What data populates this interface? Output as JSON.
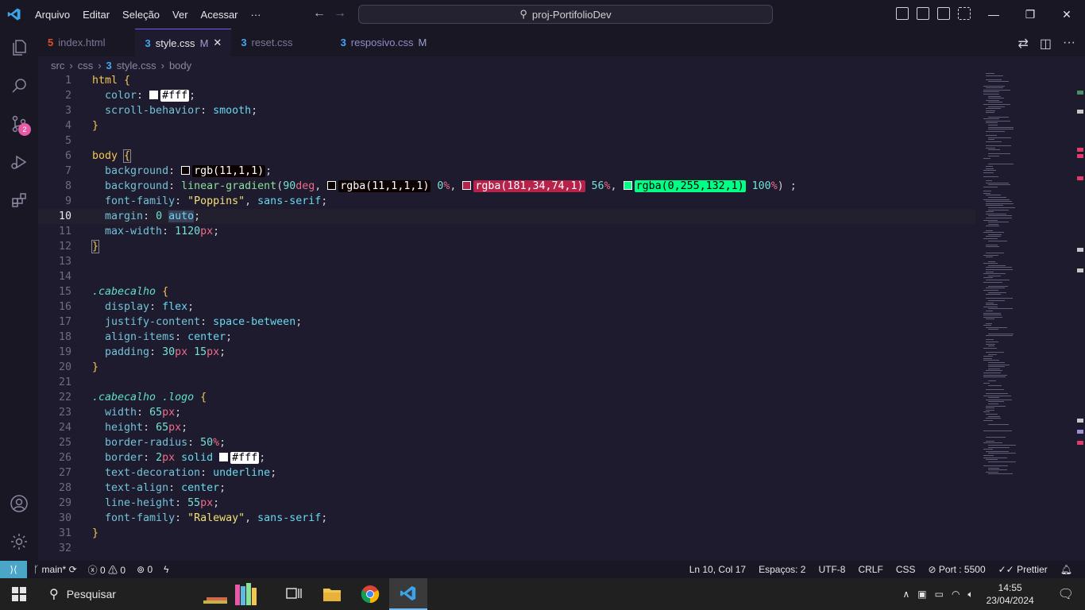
{
  "menu": [
    "Arquivo",
    "Editar",
    "Seleção",
    "Ver",
    "Acessar",
    "···"
  ],
  "command_center": "proj-PortifolioDev",
  "tabs": [
    {
      "label": "index.html",
      "mark": "",
      "icon": "html5-icon"
    },
    {
      "label": "style.css",
      "mark": "M",
      "icon": "css3-icon"
    },
    {
      "label": "reset.css",
      "mark": "",
      "icon": "css3-icon"
    },
    {
      "label": "resposivo.css",
      "mark": "M",
      "icon": "css3-icon"
    }
  ],
  "breadcrumb": [
    "src",
    "css",
    "style.css",
    "body"
  ],
  "activity_badge": "2",
  "code_lines": [
    {
      "n": "1",
      "html": "<span class='sel'>html</span> <span class='sel'>{</span>"
    },
    {
      "n": "2",
      "html": "  <span class='prop'>color</span>: <span class='chip' style='background:#fff'></span><span class='cbox' style='background:#fff;color:#000'>#fff</span>;"
    },
    {
      "n": "3",
      "html": "  <span class='prop'>scroll-behavior</span>: <span class='val'>smooth</span>;"
    },
    {
      "n": "4",
      "html": "<span class='sel'>}</span>"
    },
    {
      "n": "5",
      "html": ""
    },
    {
      "n": "6",
      "html": "<span class='sel'>body</span> <span class='sel' style='outline:1px solid #888'>{</span>"
    },
    {
      "n": "7",
      "html": "  <span class='prop'>background</span>: <span class='chip' style='background:#0b0101'></span><span class='cbox' style='background:#0b0101;color:#fff'>rgb(11,1,1)</span>;"
    },
    {
      "n": "8",
      "html": "  <span class='prop'>background</span>: <span class='fn'>linear-gradient</span>(<span class='num'>90</span><span class='unit'>deg</span>, <span class='chip' style='background:#0b0101'></span><span class='cbox' style='background:#0b0101;color:#fff'>rgba(11,1,1,1)</span> <span class='num'>0</span><span class='unit'>%</span>, <span class='chip' style='background:#b5224a'></span><span class='cbox' style='background:#b5224a;color:#fff'>rgba(181,34,74,1)</span> <span class='num'>56</span><span class='unit'>%</span>, <span class='chip' style='background:#00ff84'></span><span class='cbox' style='background:#00ff84;color:#000'>rgba(0,255,132,1)</span> <span class='num'>100</span><span class='unit'>%</span>) ;"
    },
    {
      "n": "9",
      "html": "  <span class='prop'>font-family</span>: <span class='str'>\"Poppins\"</span>, <span class='val'>sans-serif</span>;"
    },
    {
      "n": "10",
      "html": "  <span class='prop'>margin</span>: <span class='num'>0</span> <span class='val' style='background:#3a3f5a'>auto</span>;",
      "cur": true
    },
    {
      "n": "11",
      "html": "  <span class='prop'>max-width</span>: <span class='num'>1120</span><span class='unit'>px</span>;"
    },
    {
      "n": "12",
      "html": "<span class='sel' style='outline:1px solid #888'>}</span>"
    },
    {
      "n": "13",
      "html": ""
    },
    {
      "n": "14",
      "html": ""
    },
    {
      "n": "15",
      "html": "<span class='cls'>.cabecalho</span> <span class='sel'>{</span>"
    },
    {
      "n": "16",
      "html": "  <span class='prop'>display</span>: <span class='val'>flex</span>;"
    },
    {
      "n": "17",
      "html": "  <span class='prop'>justify-content</span>: <span class='val'>space-between</span>;"
    },
    {
      "n": "18",
      "html": "  <span class='prop'>align-items</span>: <span class='val'>center</span>;"
    },
    {
      "n": "19",
      "html": "  <span class='prop'>padding</span>: <span class='num'>30</span><span class='unit'>px</span> <span class='num'>15</span><span class='unit'>px</span>;"
    },
    {
      "n": "20",
      "html": "<span class='sel'>}</span>"
    },
    {
      "n": "21",
      "html": ""
    },
    {
      "n": "22",
      "html": "<span class='cls'>.cabecalho</span> <span class='cls'>.logo</span> <span class='sel'>{</span>"
    },
    {
      "n": "23",
      "html": "  <span class='prop'>width</span>: <span class='num'>65</span><span class='unit'>px</span>;"
    },
    {
      "n": "24",
      "html": "  <span class='prop'>height</span>: <span class='num'>65</span><span class='unit'>px</span>;"
    },
    {
      "n": "25",
      "html": "  <span class='prop'>border-radius</span>: <span class='num'>50</span><span class='unit'>%</span>;"
    },
    {
      "n": "26",
      "html": "  <span class='prop'>border</span>: <span class='num'>2</span><span class='unit'>px</span> <span class='val'>solid</span> <span class='chip' style='background:#fff'></span><span class='cbox' style='background:#fff;color:#000'>#fff</span>;"
    },
    {
      "n": "27",
      "html": "  <span class='prop'>text-decoration</span>: <span class='val'>underline</span>;"
    },
    {
      "n": "28",
      "html": "  <span class='prop'>text-align</span>: <span class='val'>center</span>;"
    },
    {
      "n": "29",
      "html": "  <span class='prop'>line-height</span>: <span class='num'>55</span><span class='unit'>px</span>;"
    },
    {
      "n": "30",
      "html": "  <span class='prop'>font-family</span>: <span class='str'>\"Raleway\"</span>, <span class='val'>sans-serif</span>;"
    },
    {
      "n": "31",
      "html": "<span class='sel'>}</span>"
    },
    {
      "n": "32",
      "html": ""
    }
  ],
  "status": {
    "branch": "main*",
    "errors": "0",
    "warnings": "0",
    "ports": "0",
    "position": "Ln 10, Col 17",
    "spaces": "Espaços: 2",
    "encoding": "UTF-8",
    "eol": "CRLF",
    "language": "CSS",
    "port": "Port : 5500",
    "formatter": "Prettier"
  },
  "taskbar": {
    "search": "Pesquisar",
    "time": "14:55",
    "date": "23/04/2024"
  },
  "colors": {
    "accent": "#6c5fe8",
    "remote": "#4aa5c9",
    "badge": "#e85aa6"
  }
}
